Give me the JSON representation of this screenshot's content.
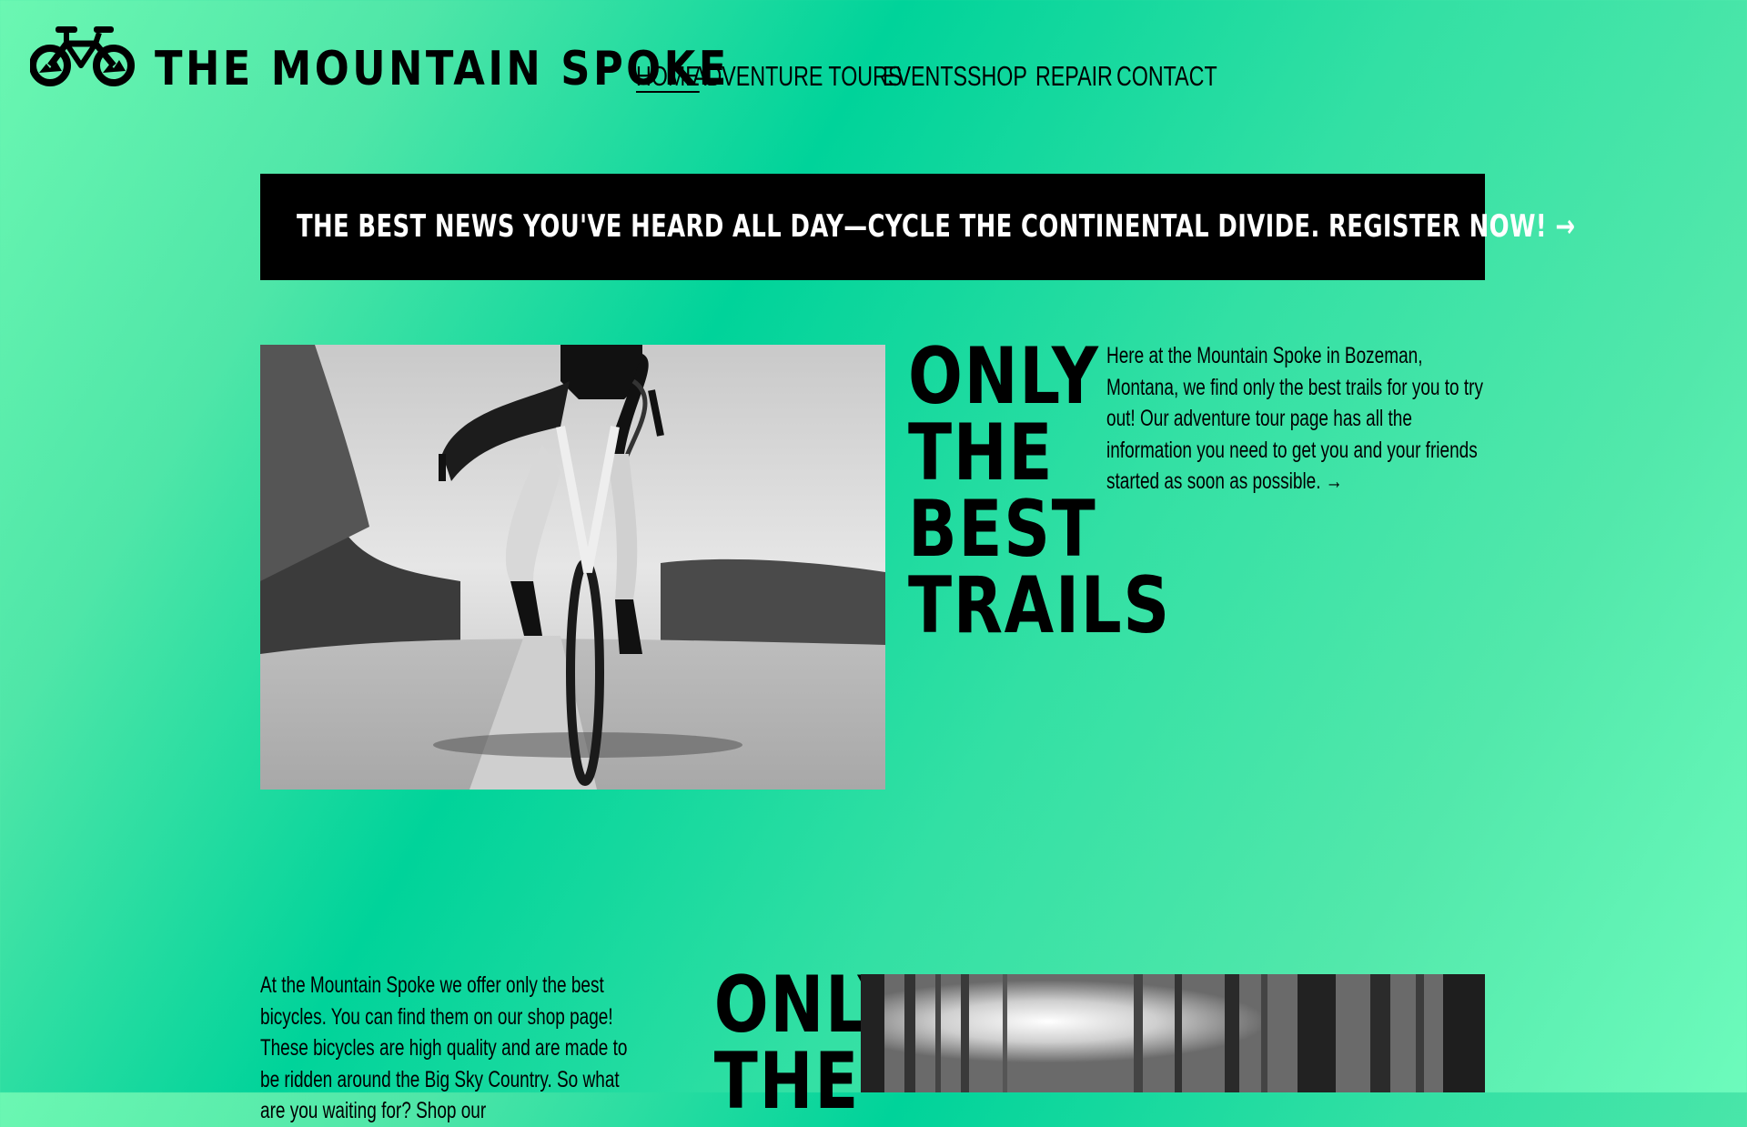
{
  "header": {
    "brand": "THE MOUNTAIN SPOKE",
    "logo_icon": "bicycle-mountain-icon",
    "nav": [
      {
        "label": "HOME",
        "active": true
      },
      {
        "label": "ADVENTURE TOURS",
        "active": false
      },
      {
        "label": "EVENTS",
        "active": false
      },
      {
        "label": "SHOP",
        "active": false
      },
      {
        "label": "REPAIR",
        "active": false
      },
      {
        "label": "CONTACT",
        "active": false
      }
    ]
  },
  "banner": {
    "text": "THE BEST NEWS YOU'VE HEARD ALL DAY—CYCLE THE CONTINENTAL DIVIDE. REGISTER NOW! →"
  },
  "section1": {
    "heading_lines": [
      "ONLY",
      "THE",
      "BEST",
      "TRAILS"
    ],
    "paragraph": "Here at the Mountain Spoke in Bozeman, Montana, we find only the best trails for you to try out! Our adventure tour page has all the information you need to get you and your friends started as soon as possible. →",
    "image": "road-cyclist-photo"
  },
  "section2": {
    "heading_lines": [
      "ONLY",
      "THE"
    ],
    "paragraph": "At the Mountain Spoke we offer only the best bicycles. You can find them on our shop page! These bicycles are high quality and are made to be ridden around the Big Sky Country. So what are you waiting for? Shop our",
    "image": "forest-sunlight-photo"
  },
  "colors": {
    "background_start": "#6bf7b2",
    "background_mid": "#00d39a",
    "background_end": "#6dfbbc",
    "banner": "#000000",
    "banner_text": "#ffffff"
  }
}
